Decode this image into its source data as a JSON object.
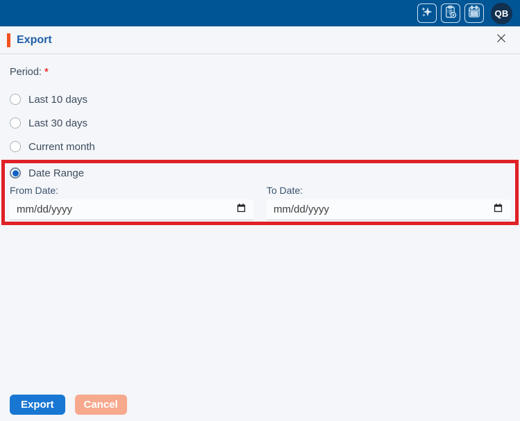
{
  "topbar": {
    "avatar_initials": "QB",
    "icons": [
      "sparkles",
      "clipboard-add",
      "calendar"
    ]
  },
  "dialog": {
    "title": "Export",
    "period": {
      "label": "Period:",
      "required_marker": "*",
      "options": [
        {
          "label": "Last 10 days",
          "selected": false
        },
        {
          "label": "Last 30 days",
          "selected": false
        },
        {
          "label": "Current month",
          "selected": false
        },
        {
          "label": "Date Range",
          "selected": true
        }
      ]
    },
    "date_range": {
      "from_label": "From Date:",
      "from_placeholder": "mm/dd/yyyy",
      "to_label": "To Date:",
      "to_placeholder": "mm/dd/yyyy"
    },
    "buttons": {
      "export": "Export",
      "cancel": "Cancel"
    }
  },
  "colors": {
    "topbar_blue": "#005595",
    "accent_orange": "#f4511e",
    "title_blue": "#1d5fa6",
    "primary_button": "#1877d2",
    "cancel_button": "#f7a98e",
    "highlight_red": "#e02127",
    "selected_radio": "#0f62c5"
  }
}
